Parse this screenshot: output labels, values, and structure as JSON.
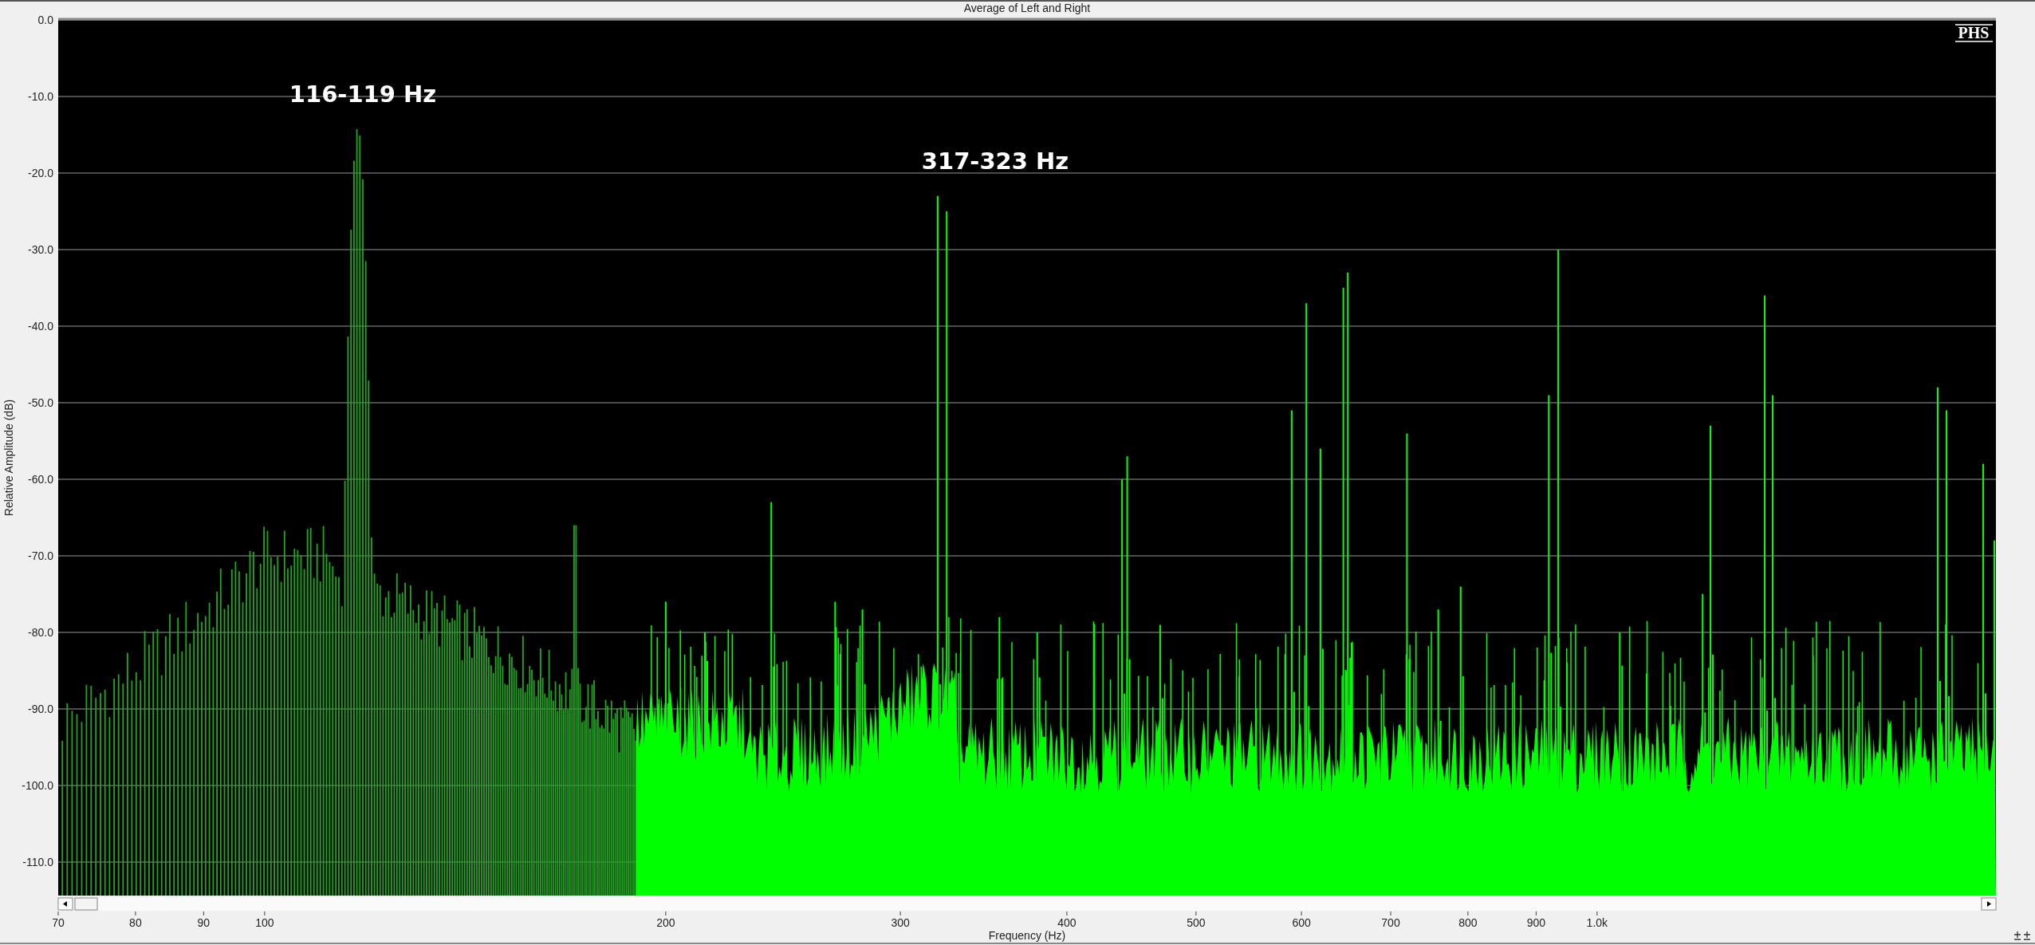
{
  "title": "Average of Left and Right",
  "logo": "PHS",
  "y_axis": {
    "label": "Relative Amplitude (dB)",
    "ticks": [
      "0.0",
      "-10.0",
      "-20.0",
      "-30.0",
      "-40.0",
      "-50.0",
      "-60.0",
      "-70.0",
      "-80.0",
      "-90.0",
      "-100.0",
      "-110.0"
    ]
  },
  "x_axis": {
    "label": "Frequency (Hz)",
    "ticks": [
      "70",
      "80",
      "90",
      "100",
      "200",
      "300",
      "400",
      "500",
      "600",
      "700",
      "800",
      "900",
      "1.0k"
    ]
  },
  "annotations": [
    {
      "text": "116-119 Hz"
    },
    {
      "text": "317-323 Hz"
    }
  ]
}
